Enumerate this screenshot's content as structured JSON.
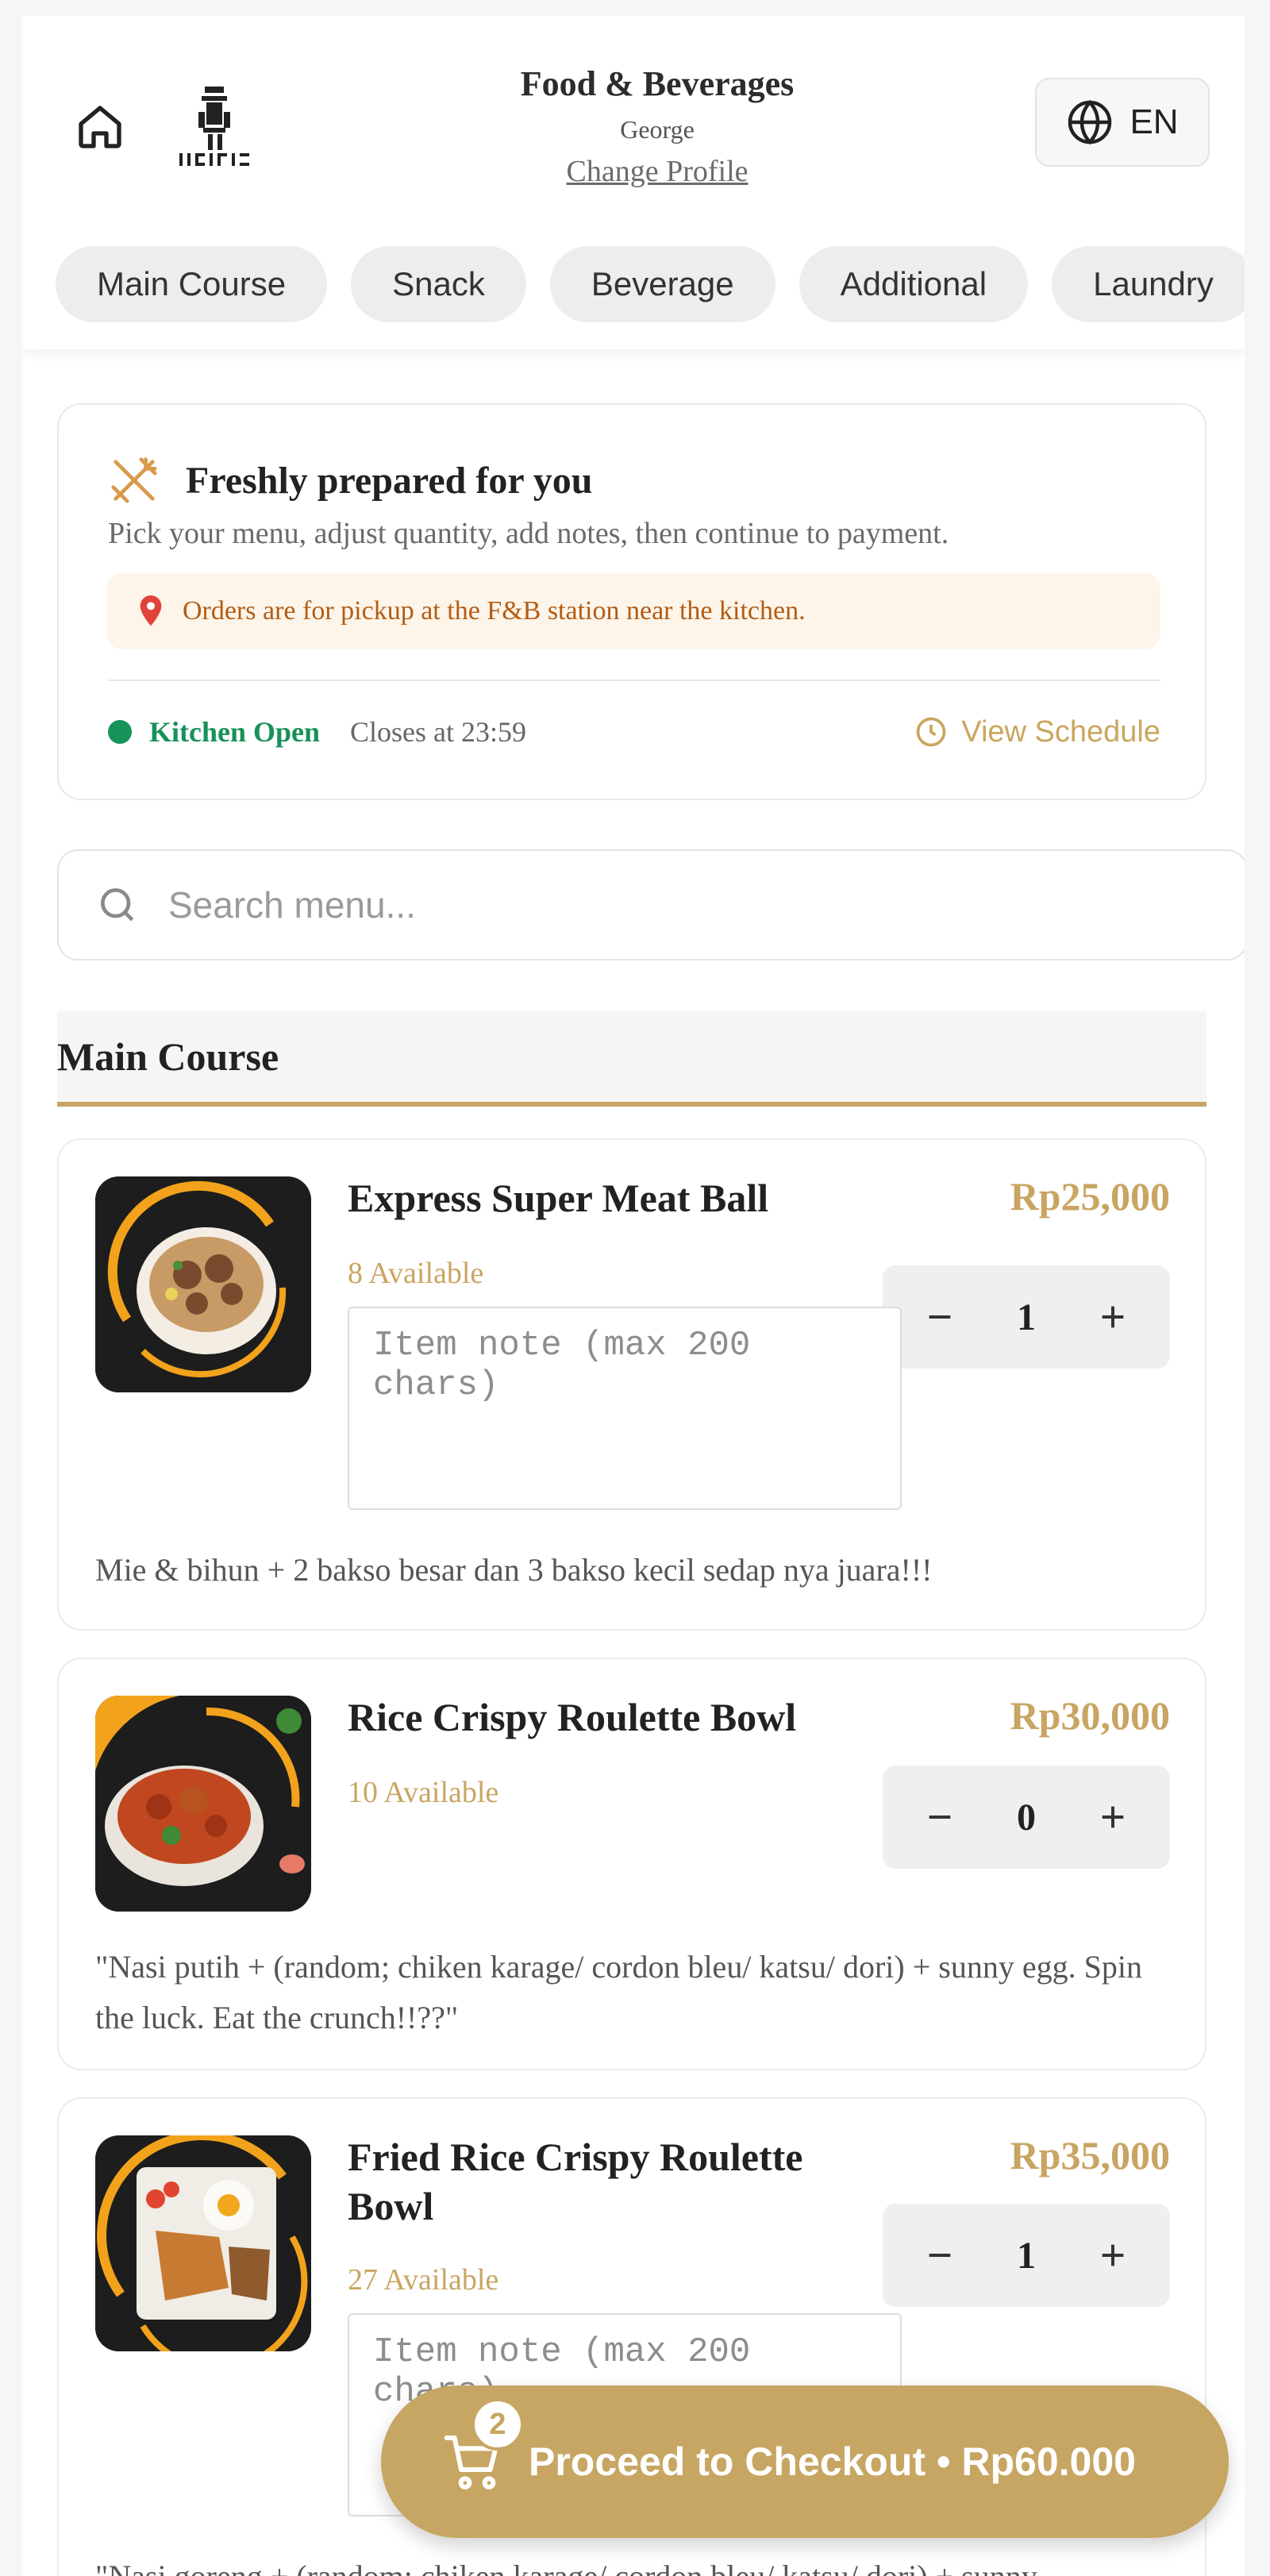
{
  "header": {
    "title": "Food & Beverages",
    "subtitle": "George",
    "change_profile": "Change Profile",
    "language": "EN",
    "icons": {
      "home": "home-icon",
      "logo": "brand-logo",
      "language": "globe-icon"
    }
  },
  "tabs": [
    {
      "label": "Main Course"
    },
    {
      "label": "Snack"
    },
    {
      "label": "Beverage"
    },
    {
      "label": "Additional"
    },
    {
      "label": "Laundry"
    }
  ],
  "intro": {
    "title": "Freshly prepared for you",
    "description": "Pick your menu, adjust quantity, add notes, then continue to payment.",
    "notice": "Orders are for pickup at the F&B station near the kitchen.",
    "status": "Kitchen Open",
    "closes": "Closes at 23:59",
    "schedule_link": "View Schedule",
    "status_color": "#18935a",
    "icons": {
      "intro": "utensils-icon",
      "notice": "map-pin-icon",
      "schedule": "clock-icon"
    }
  },
  "search": {
    "placeholder": "Search menu...",
    "value": ""
  },
  "section": {
    "title": "Main Course"
  },
  "items": [
    {
      "name": "Express Super Meat Ball",
      "available": "8 Available",
      "price": "Rp25,000",
      "quantity": "1",
      "note_placeholder": "Item note (max 200 chars)",
      "description": "Mie & bihun + 2 bakso besar dan 3 bakso kecil sedap nya juara!!!"
    },
    {
      "name": "Rice Crispy Roulette Bowl",
      "available": "10 Available",
      "price": "Rp30,000",
      "quantity": "0",
      "description": "\"Nasi putih + (random; chiken karage/ cordon bleu/ katsu/ dori) + sunny egg. Spin the luck. Eat the crunch!!??\""
    },
    {
      "name": "Fried Rice Crispy Roulette Bowl",
      "available": "27 Available",
      "price": "Rp35,000",
      "quantity": "1",
      "note_placeholder": "Item note (max 200 chars)",
      "description": "\"Nasi goreng + (random; chiken karage/ cordon bleu/ katsu/ dori) + sunny"
    }
  ],
  "checkout": {
    "label": "Proceed to Checkout • Rp60.000",
    "cart_count": "2",
    "accent_color": "#c6a662"
  },
  "colors": {
    "accent": "#c9a563",
    "open_green": "#18935a",
    "notice_bg": "#fdf5ea"
  }
}
